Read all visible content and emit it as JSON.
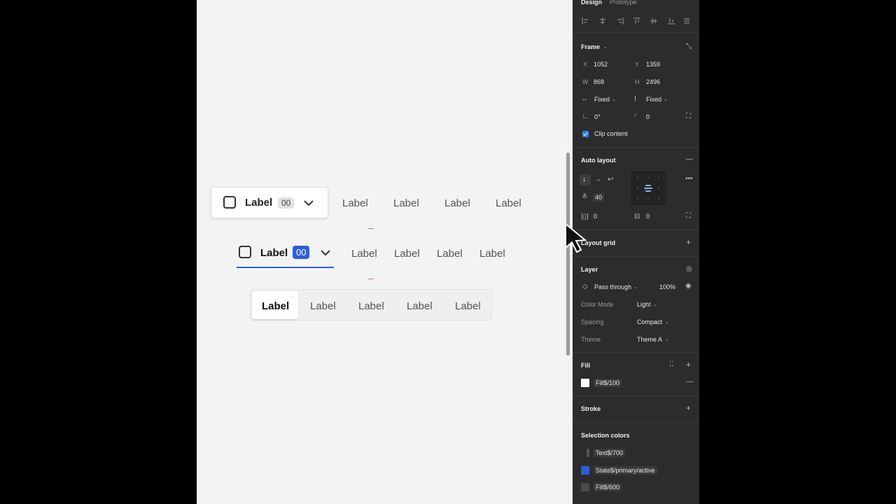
{
  "canvas": {
    "tabs_row1": {
      "label_main": "Label",
      "badge": "00",
      "items": [
        "Label",
        "Label",
        "Label",
        "Label"
      ]
    },
    "tabs_row2": {
      "label_main": "Label",
      "badge": "00",
      "items": [
        "Label",
        "Label",
        "Label",
        "Label"
      ]
    },
    "segmented": {
      "items": [
        "Label",
        "Label",
        "Label",
        "Label",
        "Label"
      ]
    }
  },
  "panel": {
    "tabs": {
      "design": "Design",
      "prototype": "Prototype"
    },
    "frame": {
      "title": "Frame",
      "x_label": "X",
      "x_value": "1052",
      "y_label": "Y",
      "y_value": "1359",
      "w_label": "W",
      "w_value": "868",
      "h_label": "H",
      "h_value": "2496",
      "h_resize": "Fixed",
      "v_resize": "Fixed",
      "rotation": "0°",
      "radius": "0",
      "clip": "Clip content"
    },
    "auto_layout": {
      "title": "Auto layout",
      "gap": "40",
      "pad_h": "0",
      "pad_v": "0"
    },
    "layout_grid": {
      "title": "Layout grid"
    },
    "layer": {
      "title": "Layer",
      "blend": "Pass through",
      "opacity": "100%",
      "color_mode_label": "Color Mode",
      "color_mode_value": "Light",
      "spacing_label": "Spacing",
      "spacing_value": "Compact",
      "theme_label": "Theme",
      "theme_value": "Theme A"
    },
    "fill": {
      "title": "Fill",
      "name": "Fill$/100",
      "color": "#ffffff"
    },
    "stroke": {
      "title": "Stroke"
    },
    "selection_colors": {
      "title": "Selection colors",
      "items": [
        {
          "name": "Text$/700",
          "color": "#2b2b2b"
        },
        {
          "name": "State$/primary/active",
          "color": "#2b5fd9"
        },
        {
          "name": "Fill$/600",
          "color": "#4a4a4a"
        }
      ]
    }
  },
  "colors": {
    "accent": "#2b5fd9",
    "panel_bg": "#2c2c2c",
    "canvas_bg": "#f3f3f3"
  }
}
